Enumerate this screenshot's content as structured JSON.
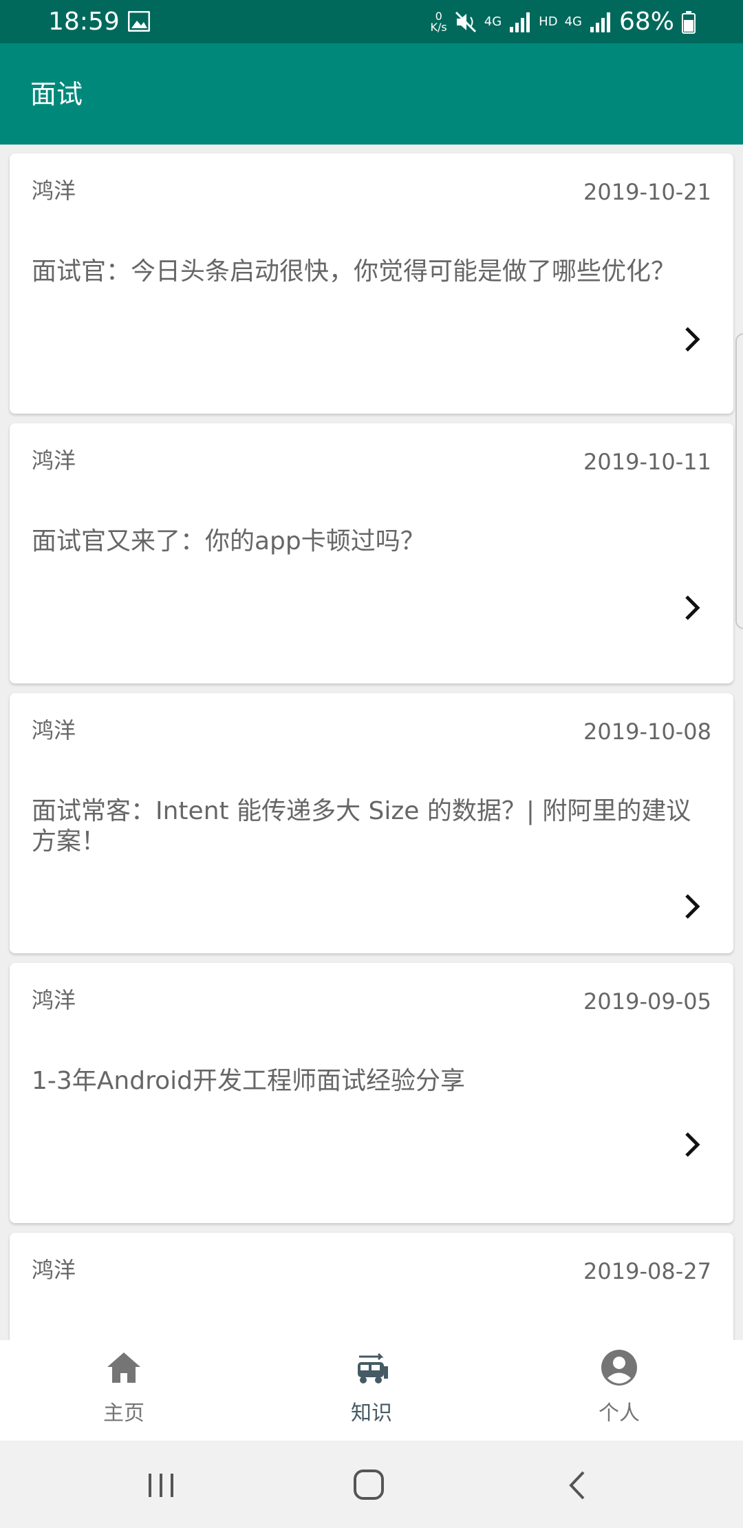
{
  "status_bar": {
    "time": "18:59",
    "net_speed_value": "0",
    "net_speed_unit": "K/s",
    "network_tag_1": "4G",
    "network_hd": "HD",
    "network_tag_2": "4G",
    "battery": "68%",
    "icons": [
      "gallery-icon",
      "mute-icon",
      "signal-icon",
      "battery-icon"
    ]
  },
  "app_bar": {
    "title": "面试",
    "background": "#00897b"
  },
  "articles": [
    {
      "author": "鸿洋",
      "date": "2019-10-21",
      "title": "面试官：今日头条启动很快，你觉得可能是做了哪些优化？"
    },
    {
      "author": "鸿洋",
      "date": "2019-10-11",
      "title": "面试官又来了：你的app卡顿过吗？"
    },
    {
      "author": "鸿洋",
      "date": "2019-10-08",
      "title": "面试常客：Intent 能传递多大 Size 的数据？| 附阿里的建议方案！"
    },
    {
      "author": "鸿洋",
      "date": "2019-09-05",
      "title": "1-3年Android开发工程师面试经验分享"
    },
    {
      "author": "鸿洋",
      "date": "2019-08-27",
      "title": ""
    }
  ],
  "bottom_nav": {
    "items": [
      {
        "label": "主页",
        "icon": "home-icon",
        "active": false
      },
      {
        "label": "知识",
        "icon": "knowledge-icon",
        "active": true
      },
      {
        "label": "个人",
        "icon": "account-icon",
        "active": false
      }
    ],
    "active_color": "#455a64",
    "inactive_color": "#757575"
  },
  "system_nav": {
    "buttons": [
      "recents-icon",
      "home-button-icon",
      "back-icon"
    ]
  }
}
